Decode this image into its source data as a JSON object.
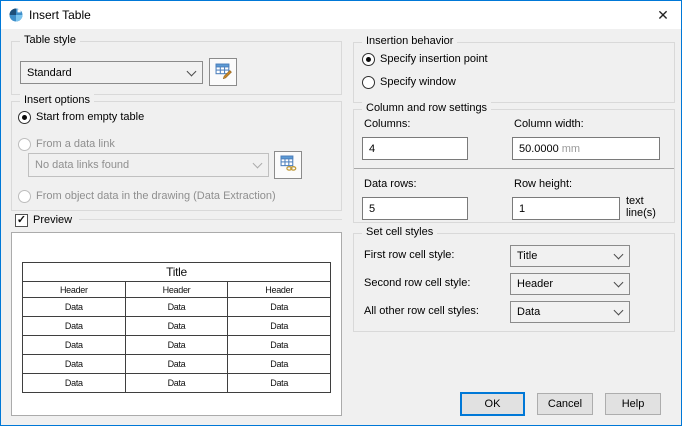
{
  "window": {
    "title": "Insert Table",
    "close_glyph": "✕"
  },
  "colors": {
    "accent": "#0078d7",
    "dialog_bg": "#f0f0f0",
    "titlebar_bg": "#ffffff",
    "disabled_text": "#8f8f8f",
    "button_bg": "#e1e1e1"
  },
  "icons": {
    "titlebar": "insert-table-app-icon",
    "table_style_button": "table-edit-icon",
    "data_link_button": "table-link-icon",
    "combo": "chevron-down-icon",
    "checkbox_check": "✓"
  },
  "table_style": {
    "legend": "Table style",
    "selected": "Standard"
  },
  "insert_options": {
    "legend": "Insert options",
    "options": [
      {
        "label": "Start from empty table",
        "selected": true,
        "enabled": true
      },
      {
        "label": "From a data link",
        "selected": false,
        "enabled": false
      },
      {
        "label": "From object data in the drawing (Data Extraction)",
        "selected": false,
        "enabled": false
      }
    ],
    "data_link_combo_value": "No data links found"
  },
  "preview": {
    "checkbox_label": "Preview",
    "checked": true,
    "table": {
      "title_cell": "Title",
      "header_cells": [
        "Header",
        "Header",
        "Header"
      ],
      "data_cell": "Data",
      "data_row_count": 5
    }
  },
  "insertion_behavior": {
    "legend": "Insertion behavior",
    "options": [
      {
        "label": "Specify insertion point",
        "selected": true,
        "enabled": true
      },
      {
        "label": "Specify window",
        "selected": false,
        "enabled": true
      }
    ]
  },
  "column_row_settings": {
    "legend": "Column and row settings",
    "columns_label": "Columns:",
    "columns_value": "4",
    "column_width_label": "Column width:",
    "column_width_value": "50.0000",
    "column_width_unit": "mm",
    "data_rows_label": "Data rows:",
    "data_rows_value": "5",
    "row_height_label": "Row height:",
    "row_height_value": "1",
    "row_height_unit": "text line(s)"
  },
  "set_cell_styles": {
    "legend": "Set cell styles",
    "rows": [
      {
        "label": "First row cell style:",
        "value": "Title"
      },
      {
        "label": "Second row cell style:",
        "value": "Header"
      },
      {
        "label": "All other row cell styles:",
        "value": "Data"
      }
    ]
  },
  "footer": {
    "ok": "OK",
    "cancel": "Cancel",
    "help": "Help"
  }
}
